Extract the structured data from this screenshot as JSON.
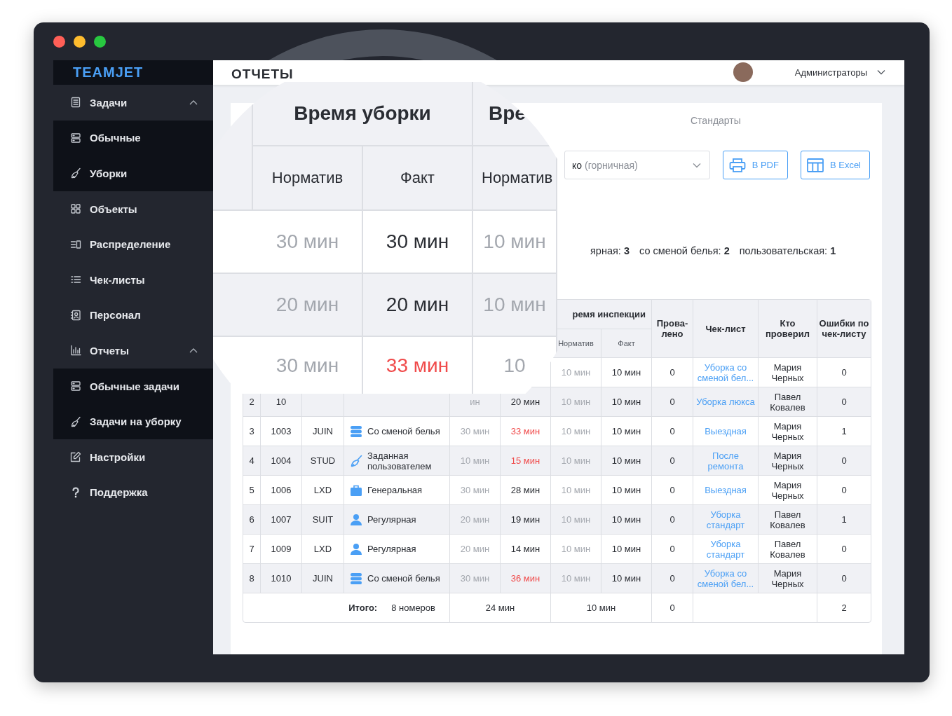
{
  "sidebar": {
    "logo": "TEAMJET",
    "items": [
      {
        "label": "Задачи",
        "kind": "tasks",
        "expanded": true,
        "children": [
          {
            "label": "Обычные",
            "kind": "regular"
          },
          {
            "label": "Уборки",
            "kind": "cleaning"
          }
        ]
      },
      {
        "label": "Объекты",
        "kind": "objects"
      },
      {
        "label": "Распределение",
        "kind": "distribution"
      },
      {
        "label": "Чек-листы",
        "kind": "checklists"
      },
      {
        "label": "Персонал",
        "kind": "staff"
      },
      {
        "label": "Отчеты",
        "kind": "reports",
        "expanded": true,
        "children": [
          {
            "label": "Обычные задачи",
            "kind": "regular"
          },
          {
            "label": "Задачи на уборку",
            "kind": "cleaning"
          }
        ]
      },
      {
        "label": "Настройки",
        "kind": "settings"
      },
      {
        "label": "Поддержка",
        "kind": "support"
      }
    ]
  },
  "header": {
    "title": "ОТЧЕТЫ",
    "user_role": "Администраторы"
  },
  "tabs": [
    {
      "label": "Стандарты",
      "selected": false
    }
  ],
  "filter": {
    "value": "ко",
    "note": "(горничная)"
  },
  "export_buttons": [
    {
      "label": "В PDF",
      "kind": "pdf"
    },
    {
      "label": "В Excel",
      "kind": "excel"
    }
  ],
  "summary": [
    "ярная: **3**",
    "со сменой белья: **2**",
    "пользовательская: **1**"
  ],
  "table": {
    "header": {
      "inspection_time": "ремя инспекции",
      "inspection_norm": "Норматив",
      "inspection_fact": "Факт",
      "failed": "Прова-лено",
      "checklist": "Чек-лист",
      "inspector": "Кто проверил",
      "errors": "Ошибки по чек-листу"
    },
    "rows": [
      {
        "insp_norm": "10 мин",
        "insp_fact": "10 мин",
        "failed": "0",
        "checklist": "Уборка со сменой бел...",
        "inspector": "Мария Черных",
        "errors": "0"
      },
      {
        "n": "2",
        "room": "10",
        "clean_norm": "ин",
        "clean_fact": "20 мин",
        "clean_late": false,
        "insp_norm": "10 мин",
        "insp_fact": "10 мин",
        "failed": "0",
        "checklist": "Уборка люкса",
        "inspector": "Павел Ковалев",
        "errors": "0"
      },
      {
        "n": "3",
        "room": "1003",
        "category": "JUIN",
        "kind": "linen",
        "type": "Со сменой белья",
        "clean_norm": "30 мин",
        "clean_fact": "33 мин",
        "clean_late": true,
        "insp_norm": "10 мин",
        "insp_fact": "10 мин",
        "failed": "0",
        "checklist": "Выездная",
        "inspector": "Мария Черных",
        "errors": "1"
      },
      {
        "n": "4",
        "room": "1004",
        "category": "STUD",
        "kind": "custom",
        "type": "Заданная пользователем",
        "clean_norm": "10 мин",
        "clean_fact": "15 мин",
        "clean_late": true,
        "insp_norm": "10 мин",
        "insp_fact": "10 мин",
        "failed": "0",
        "checklist": "После ремонта",
        "inspector": "Мария Черных",
        "errors": "0"
      },
      {
        "n": "5",
        "room": "1006",
        "category": "LXD",
        "kind": "general",
        "type": "Генеральная",
        "clean_norm": "30 мин",
        "clean_fact": "28 мин",
        "clean_late": false,
        "insp_norm": "10 мин",
        "insp_fact": "10 мин",
        "failed": "0",
        "checklist": "Выездная",
        "inspector": "Мария Черных",
        "errors": "0"
      },
      {
        "n": "6",
        "room": "1007",
        "category": "SUIT",
        "kind": "regular",
        "type": "Регулярная",
        "clean_norm": "20 мин",
        "clean_fact": "19 мин",
        "clean_late": false,
        "insp_norm": "10 мин",
        "insp_fact": "10 мин",
        "failed": "0",
        "checklist": "Уборка стандарт",
        "inspector": "Павел Ковалев",
        "errors": "1"
      },
      {
        "n": "7",
        "room": "1009",
        "category": "LXD",
        "kind": "regular",
        "type": "Регулярная",
        "clean_norm": "20 мин",
        "clean_fact": "14 мин",
        "clean_late": false,
        "insp_norm": "10 мин",
        "insp_fact": "10 мин",
        "failed": "0",
        "checklist": "Уборка стандарт",
        "inspector": "Павел Ковалев",
        "errors": "0"
      },
      {
        "n": "8",
        "room": "1010",
        "category": "JUIN",
        "kind": "linen",
        "type": "Со сменой белья",
        "clean_norm": "30 мин",
        "clean_fact": "36 мин",
        "clean_late": true,
        "insp_norm": "10 мин",
        "insp_fact": "10 мин",
        "failed": "0",
        "checklist": "Уборка со сменой бел...",
        "inspector": "Мария Черных",
        "errors": "0"
      }
    ],
    "total": {
      "label": "Итого:",
      "rooms": "8 номеров",
      "clean_time": "24 мин",
      "insp_time": "10 мин",
      "failed": "0",
      "errors": "2"
    }
  },
  "magnifier": {
    "header": [
      "Время уборки",
      "Вре"
    ],
    "subheader": [
      "Норматив",
      "Факт",
      "Норматив"
    ],
    "rows": [
      {
        "norm": "30 мин",
        "fact": "30 мин",
        "late": false,
        "insp": "10 мин"
      },
      {
        "norm": "20 мин",
        "fact": "20 мин",
        "late": false,
        "insp": "10 мин"
      },
      {
        "norm": "30 мин",
        "fact": "33 мин",
        "late": true,
        "insp": "10"
      }
    ]
  }
}
